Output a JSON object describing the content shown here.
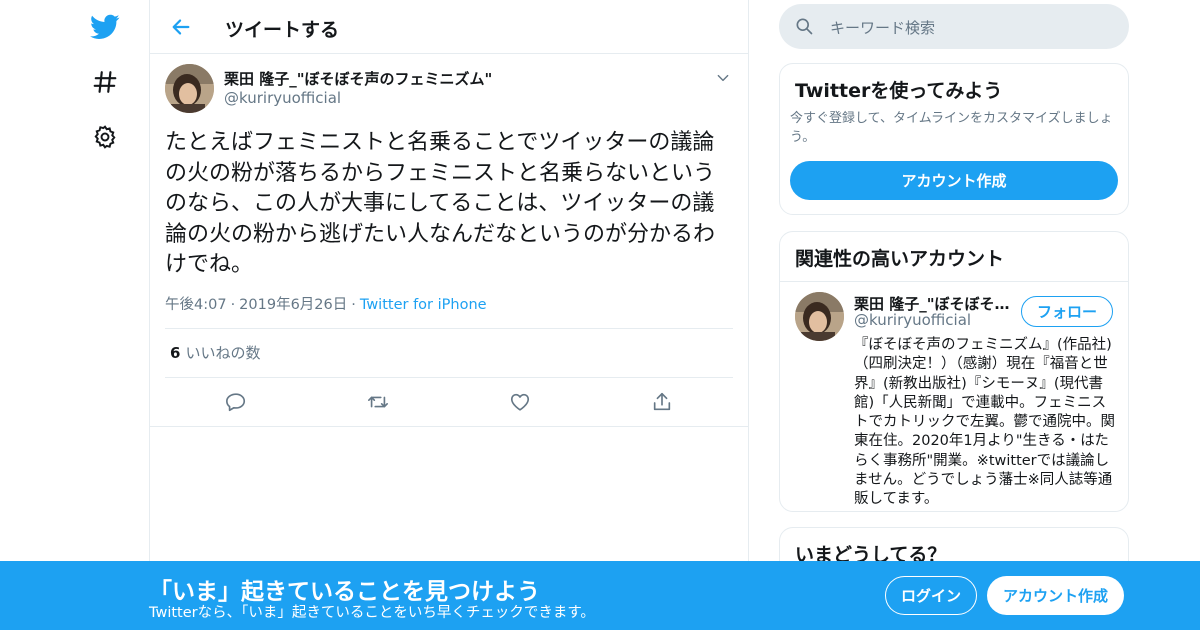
{
  "colors": {
    "accent": "#1da1f2",
    "text": "#14171a",
    "muted": "#657786",
    "border": "#e6ecf0"
  },
  "nav": {
    "icons": [
      "twitter-logo-icon",
      "hashtag-icon",
      "gear-icon"
    ]
  },
  "header": {
    "title": "ツイートする"
  },
  "tweet": {
    "author_name": "栗田 隆子_\"ぼそぼそ声のフェミニズム\"",
    "author_handle": "@kuriryuofficial",
    "text": "たとえばフェミニストと名乗ることでツイッターの議論の火の粉が落ちるからフェミニストと名乗らないというのなら、この人が大事にしてることは、ツイッターの議論の火の粉から逃げたい人なんだなというのが分かるわけでね。",
    "time": "午後4:07",
    "date": "2019年6月26日",
    "source": "Twitter for iPhone",
    "likes_count": "6",
    "likes_label": "いいねの数"
  },
  "search": {
    "placeholder": "キーワード検索"
  },
  "signup_card": {
    "title": "Twitterを使ってみよう",
    "description": "今すぐ登録して、タイムラインをカスタマイズしましょう。",
    "button": "アカウント作成"
  },
  "related_card": {
    "title": "関連性の高いアカウント",
    "name": "栗田 隆子_\"ぼそぼそ声のフェミニズム\"",
    "handle": "@kuriryuofficial",
    "follow": "フォロー",
    "bio": "『ぼそぼそ声のフェミニズム』(作品社)（四刷決定！）（感謝）現在『福音と世界』(新教出版社)『シモーヌ』(現代書館)「人民新聞」で連載中。フェミニストでカトリックで左翼。鬱で通院中。関東在住。2020年1月より\"生きる・はたらく事務所\"開業。※twitterでは議論しません。どうでしょう藩士※同人誌等通販してます。"
  },
  "trends_card": {
    "title": "いまどうしてる？"
  },
  "banner": {
    "title": "「いま」起きていることを見つけよう",
    "subtitle": "Twitterなら、「いま」起きていることをいち早くチェックできます。",
    "login": "ログイン",
    "signup": "アカウント作成"
  }
}
